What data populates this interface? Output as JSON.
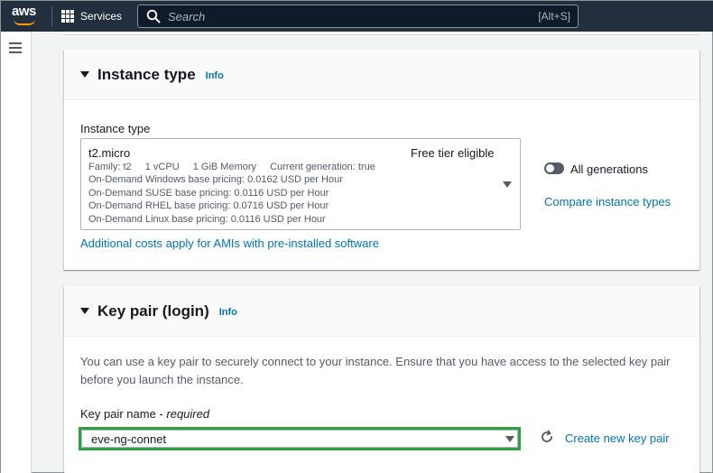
{
  "topnav": {
    "logo_text": "aws",
    "services_label": "Services",
    "search_placeholder": "Search",
    "search_shortcut": "[Alt+S]"
  },
  "instance_type": {
    "title": "Instance type",
    "info": "Info",
    "field_label": "Instance type",
    "selected": {
      "name": "t2.micro",
      "badge": "Free tier eligible",
      "family": "Family: t2",
      "vcpu": "1 vCPU",
      "memory": "1 GiB Memory",
      "generation": "Current generation: true",
      "pricing": [
        "On-Demand Windows base pricing: 0.0162 USD per Hour",
        "On-Demand SUSE base pricing: 0.0116 USD per Hour",
        "On-Demand RHEL base pricing: 0.0716 USD per Hour",
        "On-Demand Linux base pricing: 0.0116 USD per Hour"
      ]
    },
    "all_generations_label": "All generations",
    "compare_link": "Compare instance types",
    "additional_costs_link": "Additional costs apply for AMIs with pre-installed software"
  },
  "key_pair": {
    "title": "Key pair (login)",
    "info": "Info",
    "description": "You can use a key pair to securely connect to your instance. Ensure that you have access to the selected key pair before you launch the instance.",
    "field_label": "Key pair name",
    "field_label_suffix": " - ",
    "field_required": "required",
    "selected_value": "eve-ng-connet",
    "create_link": "Create new key pair"
  },
  "colors": {
    "nav_bg": "#232f3e",
    "link": "#0073bb",
    "highlight_border": "#2ea043",
    "aws_orange": "#ff9900"
  }
}
